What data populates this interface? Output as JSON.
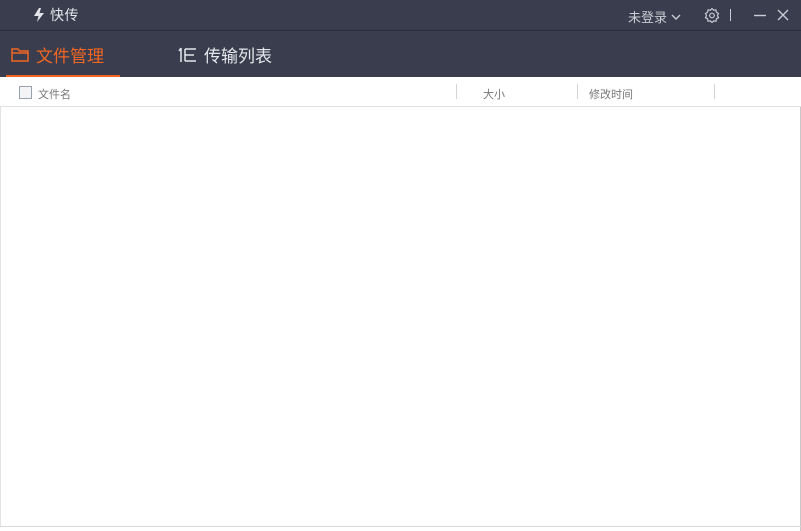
{
  "app": {
    "title": "快传",
    "login_label": "未登录"
  },
  "tabs": [
    {
      "label": "文件管理",
      "active": true
    },
    {
      "label": "传输列表",
      "active": false
    }
  ],
  "table": {
    "columns": [
      "文件名",
      "大小",
      "修改时间"
    ],
    "rows": []
  },
  "colors": {
    "titlebar_bg": "#3a3d4d",
    "accent": "#f06724"
  },
  "icons": {
    "logo": "lightning-icon",
    "login_dropdown": "chevron-down-icon",
    "settings": "gear-icon",
    "minimize": "minimize-icon",
    "close": "close-icon",
    "files_tab": "folder-icon",
    "transfer_tab": "transfer-list-icon"
  }
}
